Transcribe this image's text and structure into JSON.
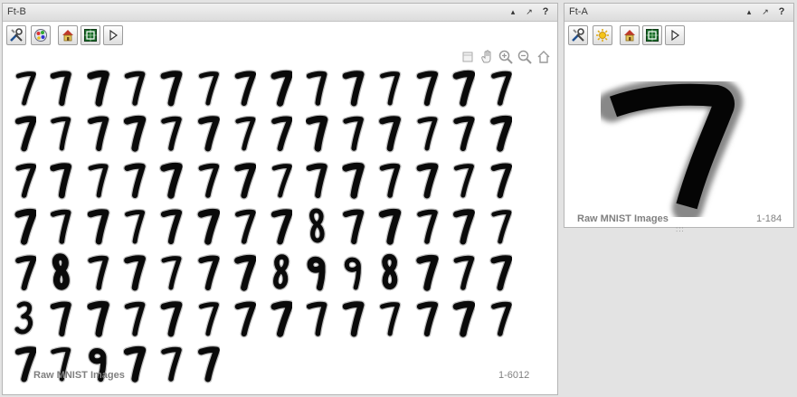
{
  "panel_b": {
    "title": "Ft-B",
    "caption": "Raw MNIST Images",
    "count": "1-6012",
    "digits": [
      "7",
      "7",
      "7",
      "7",
      "7",
      "7",
      "7",
      "7",
      "7",
      "7",
      "7",
      "7",
      "7",
      "7",
      "7",
      "7",
      "7",
      "7",
      "7",
      "7",
      "7",
      "7",
      "7",
      "7",
      "7",
      "7",
      "7",
      "7",
      "7",
      "7",
      "7",
      "7",
      "7",
      "7",
      "7",
      "7",
      "7",
      "7",
      "7",
      "7",
      "7",
      "7",
      "7",
      "7",
      "7",
      "7",
      "7",
      "7",
      "7",
      "7",
      "8",
      "7",
      "7",
      "7",
      "7",
      "7",
      "7",
      "8",
      "7",
      "7",
      "7",
      "7",
      "7",
      "8",
      "9",
      "9",
      "8",
      "7",
      "7",
      "7",
      "3",
      "7",
      "7",
      "7",
      "7",
      "7",
      "7",
      "7",
      "7",
      "7",
      "7",
      "7",
      "7",
      "7",
      "7",
      "7",
      "9",
      "7",
      "7",
      "7"
    ]
  },
  "panel_a": {
    "title": "Ft-A",
    "caption": "Raw MNIST Images",
    "count": "1-184",
    "digit": "7"
  },
  "window_controls": {
    "minimize": "▴",
    "undock": "↗",
    "help": "?"
  },
  "toolbar_b": [
    "tools-icon",
    "palette-icon",
    "home-icon",
    "grid-select-icon",
    "play-icon"
  ],
  "toolbar_a": [
    "tools-icon",
    "sun-icon",
    "home-icon",
    "grid-select-icon",
    "play-icon"
  ],
  "axis_tools": [
    "brush-icon",
    "pan-icon",
    "zoom-in-icon",
    "zoom-out-icon",
    "home-view-icon"
  ]
}
